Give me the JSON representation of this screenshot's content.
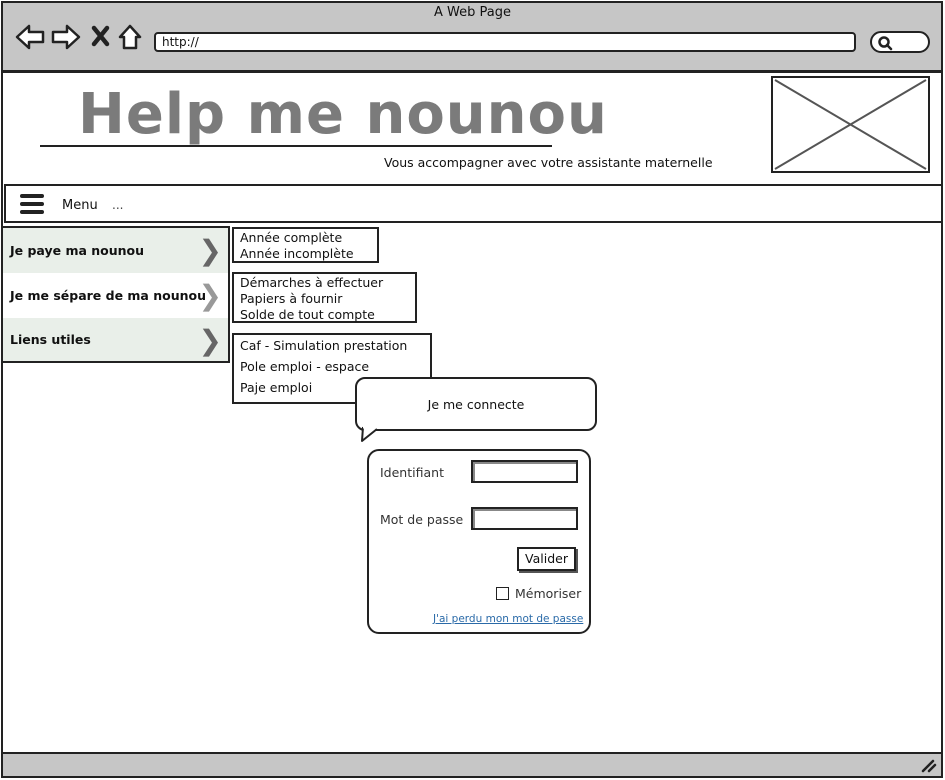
{
  "browser": {
    "title": "A Web Page",
    "url": "http://"
  },
  "header": {
    "site_title": "Help me nounou",
    "tagline": "Vous accompagner avec votre assistante maternelle"
  },
  "menu": {
    "label": "Menu",
    "more": "..."
  },
  "sidebar": {
    "items": [
      {
        "label": "Je paye ma nounou"
      },
      {
        "label": "Je me sépare de ma nounou"
      },
      {
        "label": "Liens utiles"
      }
    ]
  },
  "submenus": {
    "paye": [
      "Année complète",
      "Année incomplète"
    ],
    "separe": [
      "Démarches à effectuer",
      "Papiers à fournir",
      "Solde de tout compte"
    ],
    "liens": [
      "Caf - Simulation prestation",
      "Pole emploi - espace",
      "Paje emploi"
    ]
  },
  "login": {
    "bubble": "Je me connecte",
    "username_label": "Identifiant",
    "username_value": "",
    "password_label": "Mot de passe",
    "password_value": "",
    "submit": "Valider",
    "remember": "Mémoriser",
    "forgot": "J'ai perdu mon mot de passe"
  }
}
